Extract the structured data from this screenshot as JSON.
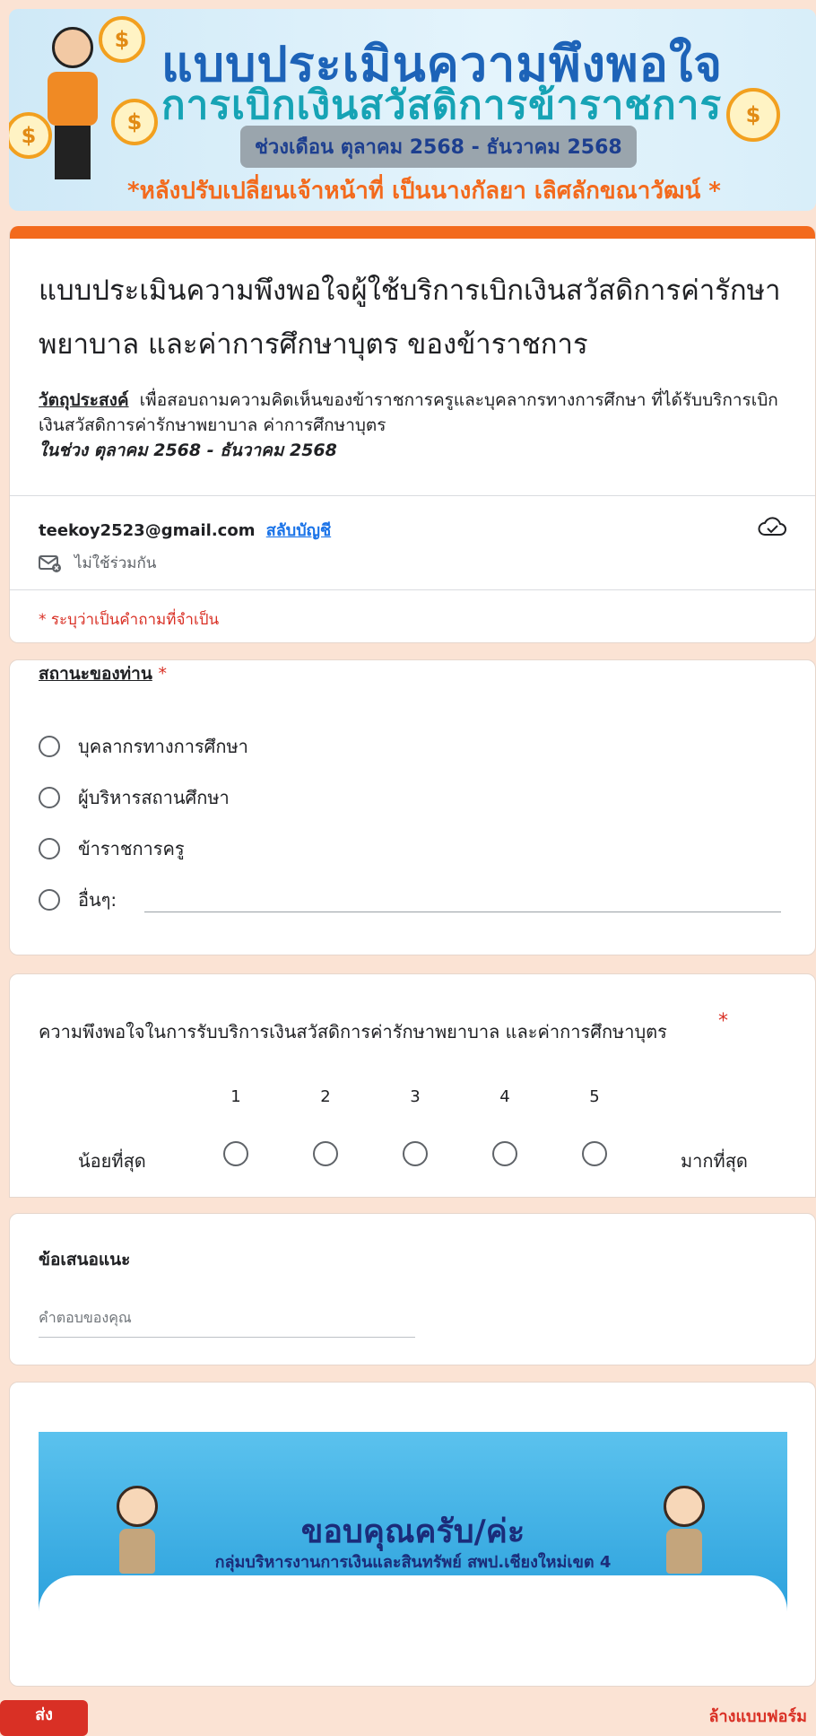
{
  "banner": {
    "title_line1": "แบบประเมินความพึงพอใจ",
    "title_line2": "การเบิกเงินสวัสดิการข้าราชการ",
    "period": "ช่วงเดือน ตุลาคม 2568 - ธันวาคม 2568",
    "note": "*หลังปรับเปลี่ยนเจ้าหน้าที่ เป็นนางกัลยา เลิศลักขณาวัฒน์ *"
  },
  "form": {
    "title": "แบบประเมินความพึงพอใจผู้ใช้บริการเบิกเงินสวัสดิการค่ารักษาพยาบาล และค่าการศึกษาบุตร ของข้าราชการ",
    "purpose_label": "วัตถุประสงค์",
    "purpose_text": "เพื่อสอบถามความคิดเห็นของข้าราชการครูและบุคลากรทางการศึกษา ที่ได้รับบริการเบิกเงินสวัสดิการค่ารักษาพยาบาล ค่าการศึกษาบุตร",
    "purpose_period": "ในช่วง ตุลาคม 2568 - ธันวาคม 2568",
    "account_email": "teekoy2523@gmail.com",
    "switch_account": "สลับบัญชี",
    "not_shared": "ไม่ใช้ร่วมกัน",
    "required_note": "* ระบุว่าเป็นคำถามที่จำเป็น"
  },
  "q1": {
    "label": "สถานะของท่าน",
    "required_mark": "*",
    "options": [
      "บุคลากรทางการศึกษา",
      "ผู้บริหารสถานศึกษา",
      "ข้าราชการครู",
      "อื่นๆ:"
    ]
  },
  "q2": {
    "label": "ความพึงพอใจในการรับบริการเงินสวัสดิการค่ารักษาพยาบาล และค่าการศึกษาบุตร",
    "required_mark": "*",
    "scale": [
      "1",
      "2",
      "3",
      "4",
      "5"
    ],
    "low_label": "น้อยที่สุด",
    "high_label": "มากที่สุด"
  },
  "q3": {
    "label": "ข้อเสนอแนะ",
    "placeholder": "คำตอบของคุณ"
  },
  "thanks": {
    "main": "ขอบคุณครับ/ค่ะ",
    "sub": "กลุ่มบริหารงานการเงินและสินทรัพย์ สพป.เชียงใหม่เขต 4"
  },
  "footer": {
    "submit": "ส่ง",
    "clear": "ล้างแบบฟอร์ม"
  }
}
